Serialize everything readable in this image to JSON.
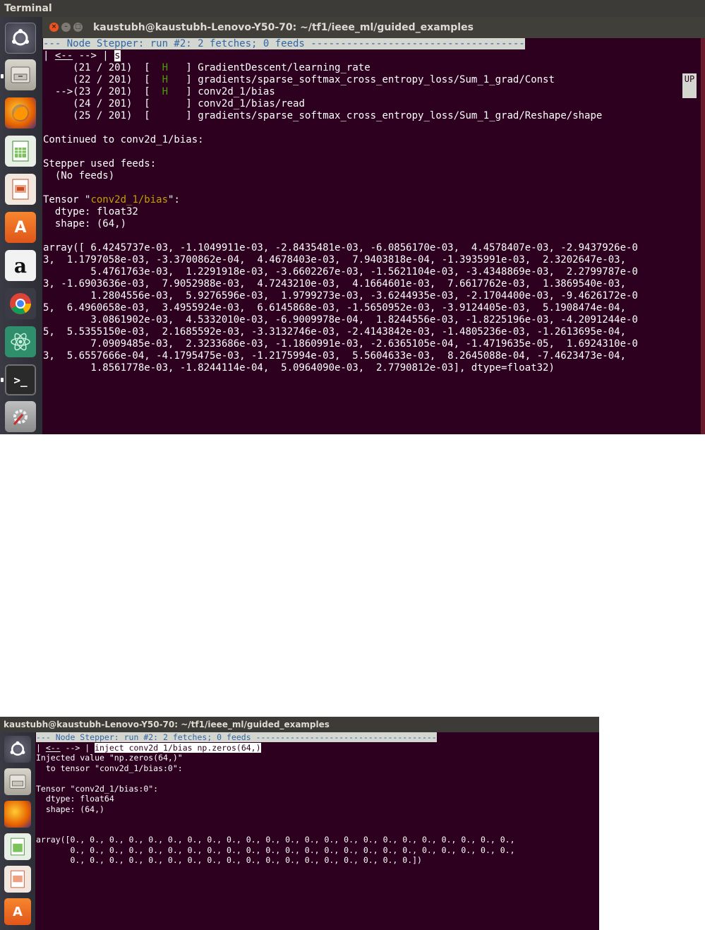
{
  "shot1": {
    "panel_title": "Terminal",
    "window_title": "kaustubh@kaustubh-Lenovo-Y50-70: ~/tf1/ieee_ml/guided_examples",
    "header": "--- Node Stepper: run #2: 2 fetches; 0 feeds ------------------------------------",
    "nav": {
      "prefix": "| ",
      "back": "<--",
      "middle": " --> | ",
      "cursor": "s"
    },
    "nodes": [
      {
        "arrow": "   ",
        "index": "(21 / 201)",
        "bl": "  [ ",
        "flag": " H ",
        "br": "  ] ",
        "name": "GradientDescent/learning_rate"
      },
      {
        "arrow": "   ",
        "index": "(22 / 201)",
        "bl": "  [ ",
        "flag": " H ",
        "br": "  ] ",
        "name": "gradients/sparse_softmax_cross_entropy_loss/Sum_1_grad/Const"
      },
      {
        "arrow": "-->",
        "index": "(23 / 201)",
        "bl": "  [ ",
        "flag": " H ",
        "br": "  ] ",
        "name": "conv2d_1/bias"
      },
      {
        "arrow": "   ",
        "index": "(24 / 201)",
        "bl": "  [ ",
        "flag": "   ",
        "br": "  ] ",
        "name": "conv2d_1/bias/read"
      },
      {
        "arrow": "   ",
        "index": "(25 / 201)",
        "bl": "  [ ",
        "flag": "   ",
        "br": "  ] ",
        "name": "gradients/sparse_softmax_cross_entropy_loss/Sum_1_grad/Reshape/shape"
      }
    ],
    "continued": "Continued to conv2d_1/bias:",
    "stepper_feeds": "Stepper used feeds:",
    "no_feeds": "  (No feeds)",
    "tensor_prefix": "Tensor \"",
    "tensor_name": "conv2d_1/bias",
    "tensor_suffix": "\":",
    "dtype": "  dtype: float32",
    "shape": "  shape: (64,)",
    "array_lines": [
      "array([ 6.4245737e-03, -1.1049911e-03, -2.8435481e-03, -6.0856170e-03,  4.4578407e-03, -2.9437926e-0",
      "3,  1.1797058e-03, -3.3700862e-04,  4.4678403e-03,  7.9403818e-04, -1.3935991e-03,  2.3202647e-03,",
      "        5.4761763e-03,  1.2291918e-03, -3.6602267e-03, -1.5621104e-03, -3.4348869e-03,  2.2799787e-0",
      "3, -1.6903636e-03,  7.9052988e-03,  4.7243210e-03,  4.1664601e-03,  7.6617762e-03,  1.3869540e-03,",
      "        1.2804556e-03,  5.9276596e-03,  1.9799273e-03, -3.6244935e-03, -2.1704400e-03, -9.4626172e-0",
      "5,  6.4960658e-03,  3.4955924e-03,  6.6145868e-03, -1.5650952e-03, -3.9124405e-03,  5.1908474e-04,",
      "        3.0861902e-03,  4.5332010e-03, -6.9009978e-04,  1.8244556e-03, -1.8225196e-03, -4.2091244e-0",
      "5,  5.5355150e-03,  2.1685592e-03, -3.3132746e-03, -2.4143842e-03, -1.4805236e-03, -1.2613695e-04,",
      "        7.0909485e-03,  2.3233686e-03, -1.1860991e-03, -2.6365105e-04, -1.4719635e-05,  1.6924310e-0",
      "3,  5.6557666e-04, -4.1795475e-03, -1.2175994e-03,  5.5604633e-03,  8.2645088e-04, -7.4623473e-04,",
      "        1.8561778e-03, -1.8244114e-04,  5.0964090e-03,  2.7790812e-03], dtype=float32)"
    ],
    "scroll_label": "UP",
    "launcher_icons": [
      "ubuntu-dash-icon",
      "files-icon",
      "firefox-icon",
      "calc-spreadsheet-icon",
      "impress-presentation-icon",
      "software-center-icon",
      "amazon-icon",
      "chrome-icon",
      "atom-icon",
      "terminal-icon",
      "system-settings-icon"
    ]
  },
  "shot2": {
    "window_title": "kaustubh@kaustubh-Lenovo-Y50-70: ~/tf1/ieee_ml/guided_examples",
    "header": "--- Node Stepper: run #2: 2 fetches; 0 feeds -------------------------------------",
    "nav": {
      "prefix": "| ",
      "back": "<--",
      "middle": " --> | ",
      "command": "inject conv2d_1/bias np.zeros(64,)"
    },
    "injected": "Injected value \"np.zeros(64,)\"",
    "to_tensor": "  to tensor \"conv2d_1/bias:0\":",
    "tensor": "Tensor \"conv2d_1/bias:0\":",
    "dtype": "  dtype: float64",
    "shape": "  shape: (64,)",
    "array_lines": [
      "array([0., 0., 0., 0., 0., 0., 0., 0., 0., 0., 0., 0., 0., 0., 0., 0., 0., 0., 0., 0., 0., 0., 0.,",
      "       0., 0., 0., 0., 0., 0., 0., 0., 0., 0., 0., 0., 0., 0., 0., 0., 0., 0., 0., 0., 0., 0., 0.,",
      "       0., 0., 0., 0., 0., 0., 0., 0., 0., 0., 0., 0., 0., 0., 0., 0., 0., 0.])"
    ],
    "launcher_icons": [
      "ubuntu-dash-icon",
      "files-icon",
      "firefox-icon",
      "calc-spreadsheet-icon",
      "impress-presentation-icon",
      "software-center-icon"
    ]
  }
}
